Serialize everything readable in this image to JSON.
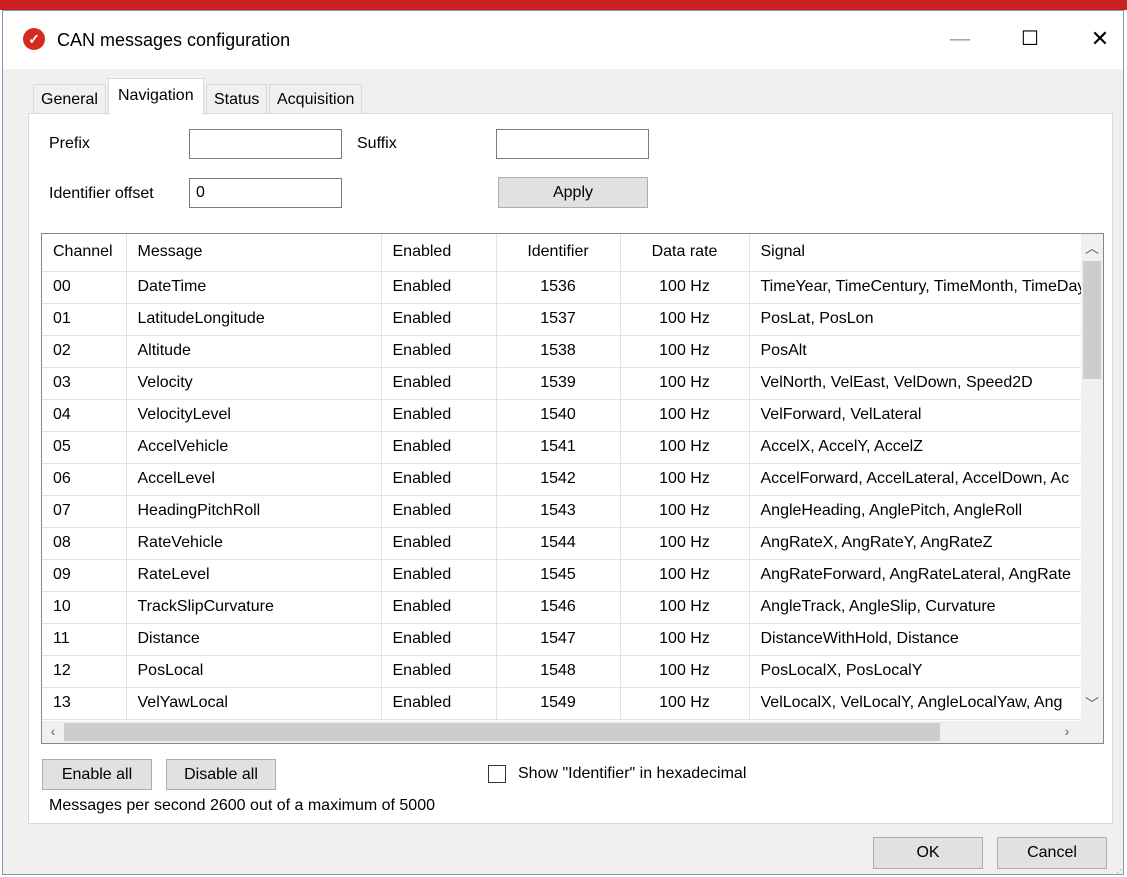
{
  "window": {
    "title": "CAN messages configuration",
    "accent": "#cc1f1f"
  },
  "tabs": [
    "General",
    "Navigation",
    "Status",
    "Acquisition"
  ],
  "active_tab": "Navigation",
  "form": {
    "prefix_label": "Prefix",
    "prefix_value": "",
    "suffix_label": "Suffix",
    "suffix_value": "",
    "offset_label": "Identifier offset",
    "offset_value": "0",
    "apply_label": "Apply"
  },
  "table": {
    "columns": [
      "Channel",
      "Message",
      "Enabled",
      "Identifier",
      "Data rate",
      "Signal"
    ],
    "rows": [
      [
        "00",
        "DateTime",
        "Enabled",
        "1536",
        "100 Hz",
        "TimeYear, TimeCentury, TimeMonth, TimeDay"
      ],
      [
        "01",
        "LatitudeLongitude",
        "Enabled",
        "1537",
        "100 Hz",
        "PosLat, PosLon"
      ],
      [
        "02",
        "Altitude",
        "Enabled",
        "1538",
        "100 Hz",
        "PosAlt"
      ],
      [
        "03",
        "Velocity",
        "Enabled",
        "1539",
        "100 Hz",
        "VelNorth, VelEast, VelDown, Speed2D"
      ],
      [
        "04",
        "VelocityLevel",
        "Enabled",
        "1540",
        "100 Hz",
        "VelForward, VelLateral"
      ],
      [
        "05",
        "AccelVehicle",
        "Enabled",
        "1541",
        "100 Hz",
        "AccelX, AccelY, AccelZ"
      ],
      [
        "06",
        "AccelLevel",
        "Enabled",
        "1542",
        "100 Hz",
        "AccelForward, AccelLateral, AccelDown, Ac"
      ],
      [
        "07",
        "HeadingPitchRoll",
        "Enabled",
        "1543",
        "100 Hz",
        "AngleHeading, AnglePitch, AngleRoll"
      ],
      [
        "08",
        "RateVehicle",
        "Enabled",
        "1544",
        "100 Hz",
        "AngRateX, AngRateY, AngRateZ"
      ],
      [
        "09",
        "RateLevel",
        "Enabled",
        "1545",
        "100 Hz",
        "AngRateForward, AngRateLateral, AngRate"
      ],
      [
        "10",
        "TrackSlipCurvature",
        "Enabled",
        "1546",
        "100 Hz",
        "AngleTrack, AngleSlip, Curvature"
      ],
      [
        "11",
        "Distance",
        "Enabled",
        "1547",
        "100 Hz",
        "DistanceWithHold, Distance"
      ],
      [
        "12",
        "PosLocal",
        "Enabled",
        "1548",
        "100 Hz",
        "PosLocalX, PosLocalY"
      ],
      [
        "13",
        "VelYawLocal",
        "Enabled",
        "1549",
        "100 Hz",
        "VelLocalX, VelLocalY, AngleLocalYaw, Ang"
      ]
    ]
  },
  "buttons": {
    "enable_all": "Enable all",
    "disable_all": "Disable all",
    "ok": "OK",
    "cancel": "Cancel"
  },
  "hex_checkbox": {
    "label": "Show \"Identifier\" in hexadecimal",
    "checked": false
  },
  "status_text": "Messages per second 2600 out of a maximum of 5000"
}
